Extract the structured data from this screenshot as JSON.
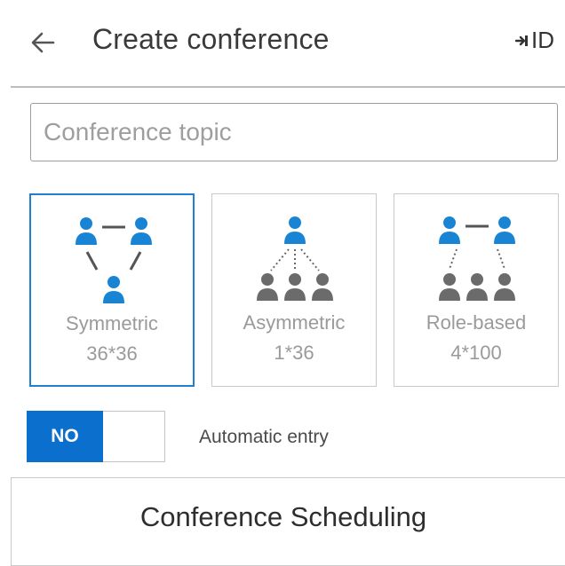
{
  "header": {
    "title": "Create conference",
    "id_label": "ID",
    "back_icon": "arrow-left-icon",
    "id_icon": "login-arrow-icon"
  },
  "topic": {
    "placeholder": "Conference topic",
    "value": ""
  },
  "modes": [
    {
      "name": "Symmetric",
      "capacity": "36*36",
      "selected": true,
      "icon": "symmetric-topology-icon"
    },
    {
      "name": "Asymmetric",
      "capacity": "1*36",
      "selected": false,
      "icon": "asymmetric-topology-icon"
    },
    {
      "name": "Role-based",
      "capacity": "4*100",
      "selected": false,
      "icon": "role-based-topology-icon"
    }
  ],
  "auto_entry": {
    "toggle_text": "NO",
    "label": "Automatic entry",
    "enabled": false
  },
  "schedule": {
    "label": "Conference Scheduling"
  },
  "colors": {
    "accent": "#0b6fce",
    "selected_border": "#1f7fd0",
    "person_blue": "#1a84d4",
    "person_gray": "#6b6b6b"
  }
}
